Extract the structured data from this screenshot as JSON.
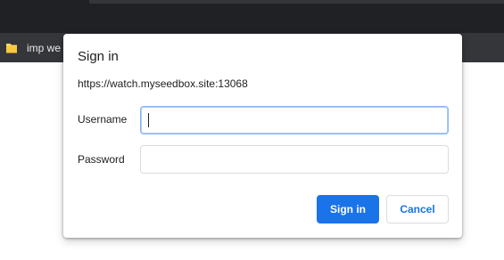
{
  "bookmarks_bar": {
    "items": [
      {
        "label": "imp we",
        "icon": "folder-icon",
        "icon_color": "#fdd663"
      }
    ]
  },
  "dialog": {
    "title": "Sign in",
    "origin": "https://watch.myseedbox.site:13068",
    "username": {
      "label": "Username",
      "value": ""
    },
    "password": {
      "label": "Password",
      "value": ""
    },
    "primary_button": "Sign in",
    "secondary_button": "Cancel"
  },
  "colors": {
    "accent": "#1a73e8",
    "browser_dark": "#202124",
    "toolbar": "#35363a"
  }
}
